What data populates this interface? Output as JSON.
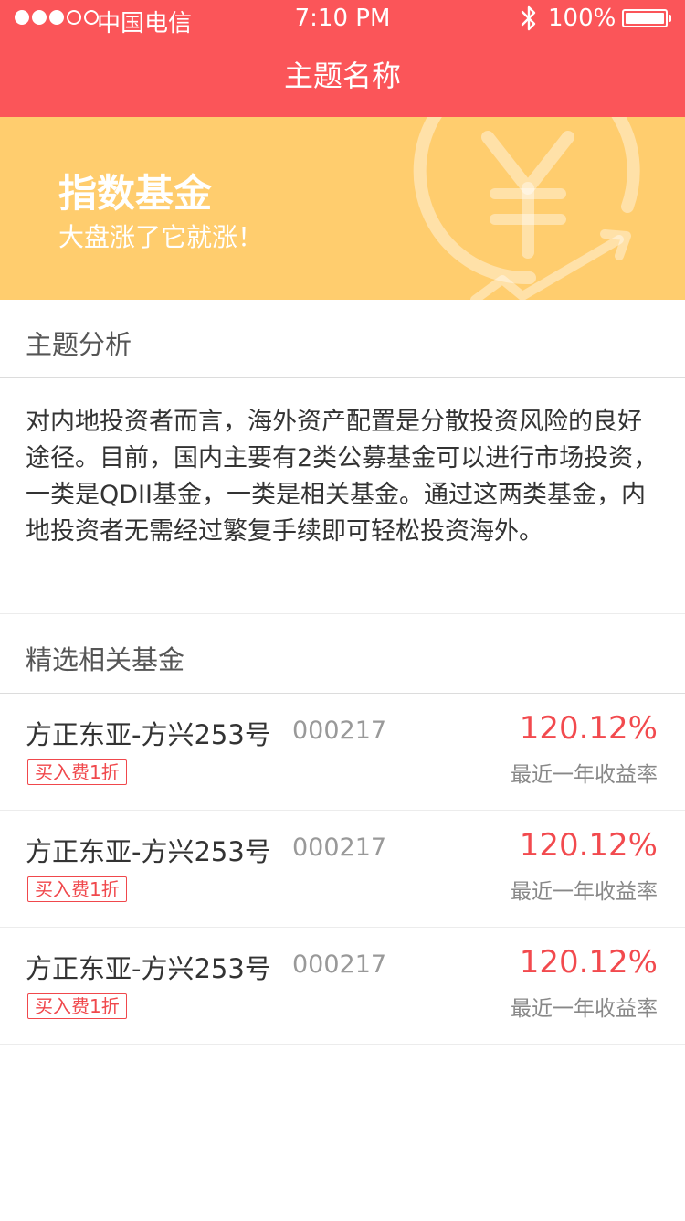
{
  "status_bar": {
    "carrier": "中国电信",
    "time": "7:10 PM",
    "battery": "100%",
    "bluetooth_glyph": "✱"
  },
  "nav": {
    "title": "主题名称"
  },
  "banner": {
    "title": "指数基金",
    "subtitle": "大盘涨了它就涨！",
    "color": "#ffcd6e",
    "icon": "yen-growth-icon"
  },
  "analysis": {
    "heading": "主题分析",
    "body": "对内地投资者而言，海外资产配置是分散投资风险的良好途径。目前，国内主要有2类公募基金可以进行市场投资，一类是QDII基金，一类是相关基金。通过这两类基金，内地投资者无需经过繁复手续即可轻松投资海外。"
  },
  "funds": {
    "heading": "精选相关基金",
    "items": [
      {
        "name": "方正东亚-方兴253号",
        "code": "000217",
        "tag": "买入费1折",
        "yield": "120.12%",
        "yield_label": "最近一年收益率"
      },
      {
        "name": "方正东亚-方兴253号",
        "code": "000217",
        "tag": "买入费1折",
        "yield": "120.12%",
        "yield_label": "最近一年收益率"
      },
      {
        "name": "方正东亚-方兴253号",
        "code": "000217",
        "tag": "买入费1折",
        "yield": "120.12%",
        "yield_label": "最近一年收益率"
      }
    ]
  },
  "colors": {
    "header": "#fb5559",
    "accent": "#f24a4e"
  }
}
